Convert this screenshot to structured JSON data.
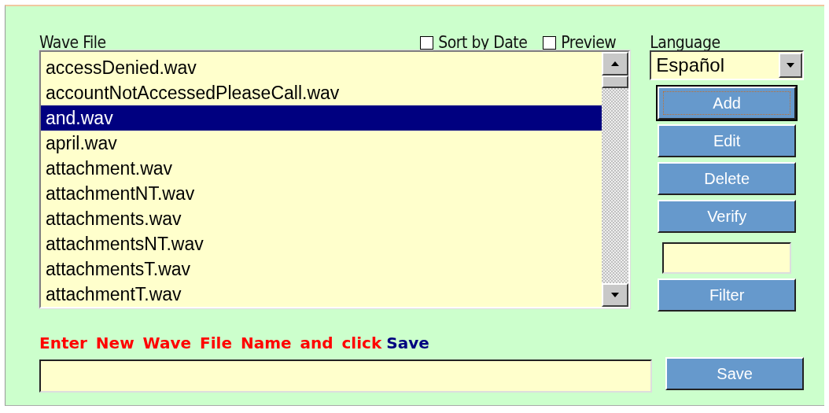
{
  "wave_file_label": "Wave File",
  "options": [
    {
      "label": "Sort by Date",
      "checked": false
    },
    {
      "label": "Preview",
      "checked": false
    }
  ],
  "wave_files": [
    {
      "name": "accessDenied.wav",
      "selected": false
    },
    {
      "name": "accountNotAccessedPleaseCall.wav",
      "selected": false
    },
    {
      "name": "and.wav",
      "selected": true
    },
    {
      "name": "april.wav",
      "selected": false
    },
    {
      "name": "attachment.wav",
      "selected": false
    },
    {
      "name": "attachmentNT.wav",
      "selected": false
    },
    {
      "name": "attachments.wav",
      "selected": false
    },
    {
      "name": "attachmentsNT.wav",
      "selected": false
    },
    {
      "name": "attachmentsT.wav",
      "selected": false
    },
    {
      "name": "attachmentT.wav",
      "selected": false
    }
  ],
  "language": {
    "label": "Language",
    "value": "Español"
  },
  "buttons": [
    {
      "label": "Add",
      "focused": true
    },
    {
      "label": "Edit",
      "focused": false
    },
    {
      "label": "Delete",
      "focused": false
    },
    {
      "label": "Verify",
      "focused": false
    }
  ],
  "filter_button": "Filter",
  "save_prompt": {
    "text": "Enter New Wave File Name and click",
    "keyword": "Save"
  },
  "save_button": "Save"
}
